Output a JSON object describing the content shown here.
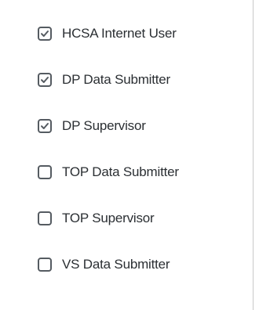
{
  "roles": [
    {
      "label": "HCSA Internet User",
      "checked": true
    },
    {
      "label": "DP Data Submitter",
      "checked": true
    },
    {
      "label": "DP Supervisor",
      "checked": true
    },
    {
      "label": "TOP Data Submitter",
      "checked": false
    },
    {
      "label": "TOP Supervisor",
      "checked": false
    },
    {
      "label": "VS Data Submitter",
      "checked": false
    }
  ],
  "colors": {
    "text": "#2b2f33",
    "checkbox_border": "#555b61",
    "divider": "#c9c9c9"
  }
}
